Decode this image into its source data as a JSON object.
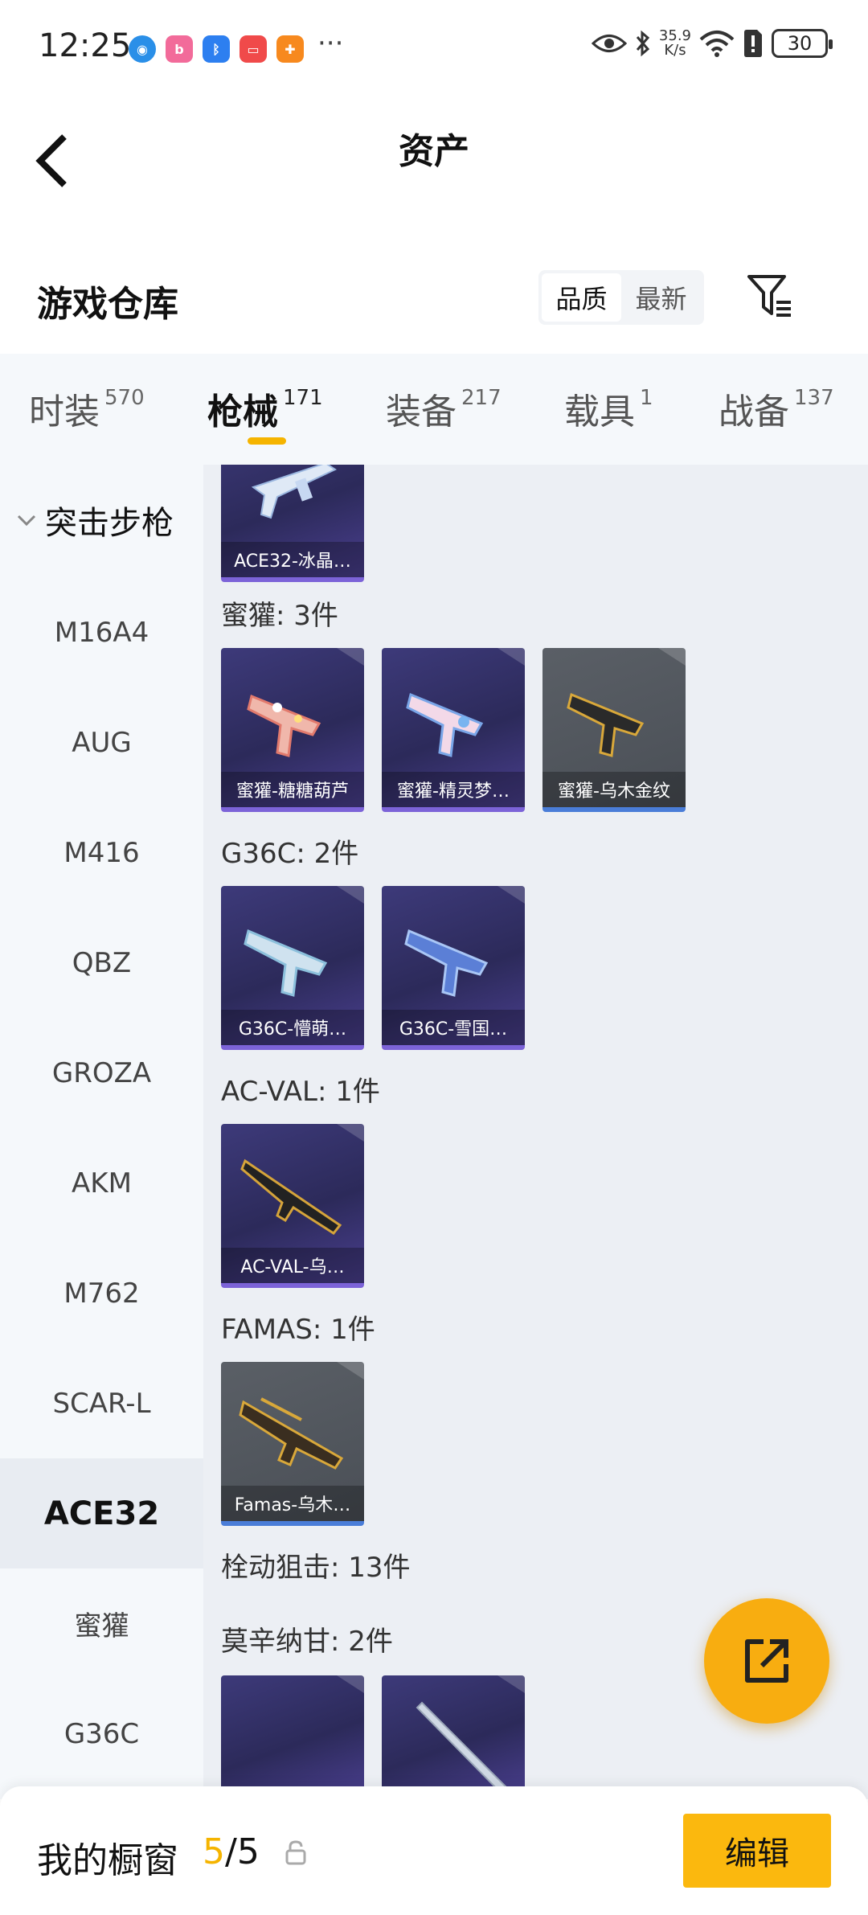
{
  "status_bar": {
    "time": "12:25",
    "app_icons": [
      "browser-icon",
      "bilibili-icon",
      "bluetooth-app-icon",
      "shop-icon",
      "game-icon"
    ],
    "more": "···",
    "net_speed_value": "35.9",
    "net_speed_unit": "K/s",
    "battery": "30"
  },
  "header": {
    "title": "资产"
  },
  "warehouse": {
    "title": "游戏仓库",
    "sort_options": [
      "品质",
      "最新"
    ],
    "active_sort": "品质"
  },
  "tabs": [
    {
      "label": "时装",
      "count": "570"
    },
    {
      "label": "枪械",
      "count": "171",
      "active": true
    },
    {
      "label": "装备",
      "count": "217"
    },
    {
      "label": "载具",
      "count": "1"
    },
    {
      "label": "战备",
      "count": "137"
    }
  ],
  "sidebar": {
    "category": "突击步枪",
    "items": [
      "M16A4",
      "AUG",
      "M416",
      "QBZ",
      "GROZA",
      "AKM",
      "M762",
      "SCAR-L",
      "ACE32",
      "蜜獾",
      "G36C"
    ],
    "active_item": "ACE32"
  },
  "content": {
    "top_card": {
      "name": "ACE32-冰晶…"
    },
    "groups": [
      {
        "label": "蜜獾: 3件",
        "items": [
          "蜜獾-糖糖葫芦",
          "蜜獾-精灵梦…",
          "蜜獾-乌木金纹"
        ]
      },
      {
        "label": "G36C: 2件",
        "items": [
          "G36C-懵萌…",
          "G36C-雪国…"
        ]
      },
      {
        "label": "AC-VAL: 1件",
        "items": [
          "AC-VAL-乌…"
        ]
      },
      {
        "label": "FAMAS: 1件",
        "items": [
          "Famas-乌木…"
        ]
      },
      {
        "label": "栓动狙击: 13件",
        "items": []
      },
      {
        "label": "莫辛纳甘: 2件",
        "items": []
      }
    ]
  },
  "bottom": {
    "showcase_label": "我的橱窗",
    "showcase_current": "5",
    "showcase_total": "/5",
    "edit_label": "编辑"
  },
  "colors": {
    "accent": "#f5b400",
    "fab": "#f8ad10",
    "card_purple": "#2c2a5a",
    "card_gray": "#4a4f56"
  }
}
